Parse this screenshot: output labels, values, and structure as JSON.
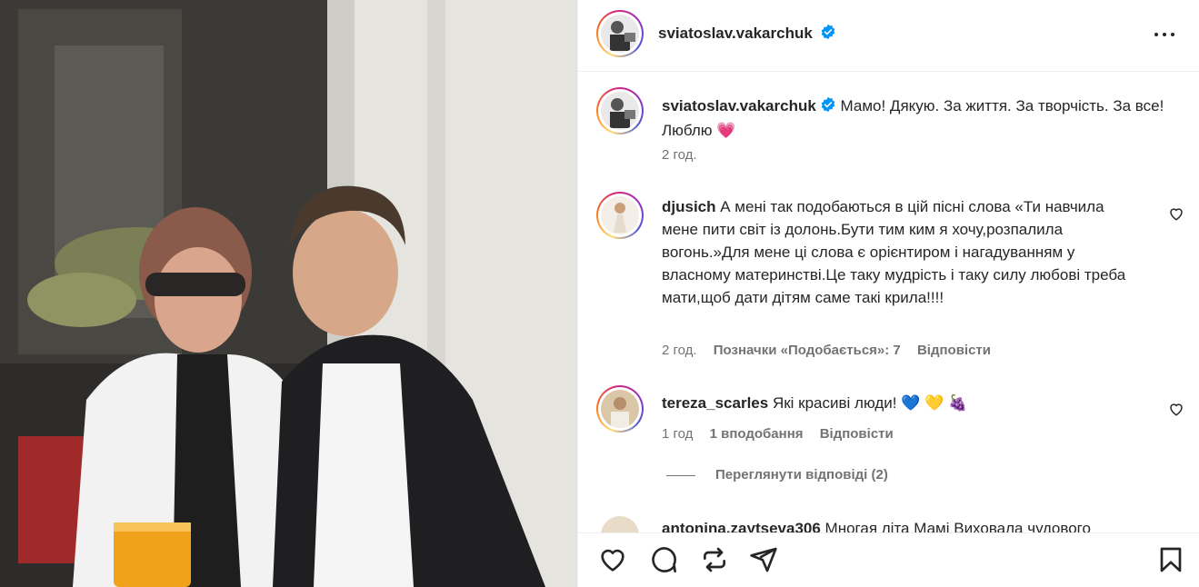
{
  "post": {
    "username": "sviatoslav.vakarchuk"
  },
  "caption": {
    "username": "sviatoslav.vakarchuk",
    "text": "Мамо! Дякую. За життя. За творчість. За все! Люблю",
    "emoji": "💗",
    "time": "2 год."
  },
  "comments": [
    {
      "username": "djusich",
      "text": "А мені так подобаються в цій пісні слова «Ти навчила мене пити світ із долонь.Бути тим ким я хочу,розпалила вогонь.»Для мене ці слова є орієнтиром і нагадуванням у власному материнстві.Це таку мудрість і таку силу любові треба мати,щоб дати дітям саме такі крила!!!!",
      "time": "2 год.",
      "likes": "Позначки «Подобається»: 7",
      "reply": "Відповісти"
    },
    {
      "username": "tereza_scarles",
      "text": "Які красиві люди!",
      "emoji": "💙 💛 🍇",
      "time": "1 год",
      "likes": "1 вподобання",
      "reply": "Відповісти",
      "view_replies": "Переглянути відповіді (2)"
    },
    {
      "username": "antonina.zaytseva306",
      "text": "Многая літа Мамі Виховала чудового"
    }
  ],
  "icons": {
    "more": "more-options-icon",
    "verified": "verified-badge-icon",
    "like": "heart-icon",
    "comment": "comment-icon",
    "repost": "repost-icon",
    "share": "share-icon",
    "save": "bookmark-icon"
  },
  "colors": {
    "verified": "#0095f6",
    "text": "#262626",
    "secondary": "#737373"
  }
}
